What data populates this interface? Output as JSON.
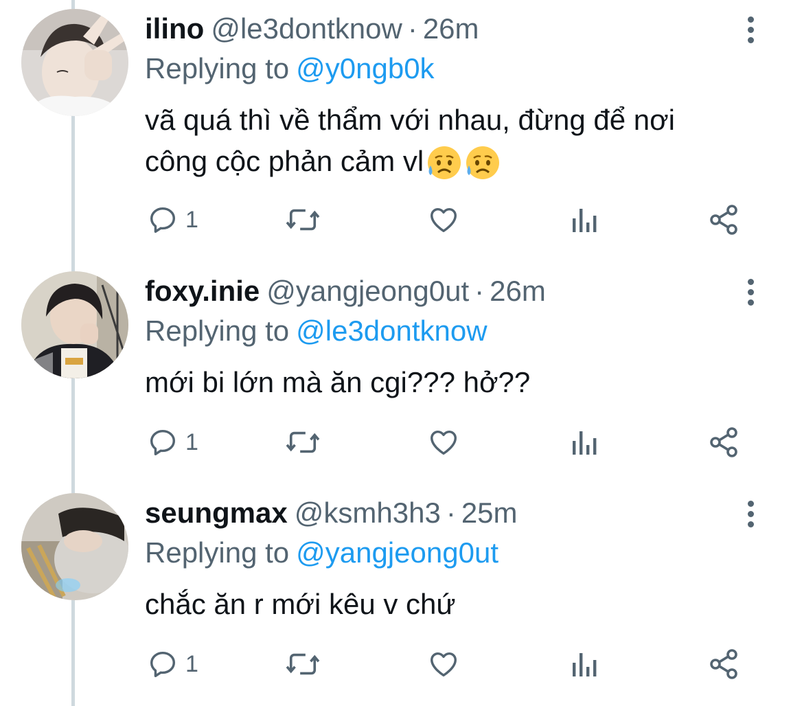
{
  "colors": {
    "text": "#0f1419",
    "secondary": "#536471",
    "accent": "#1d9bf0",
    "thread_line": "#cfd9de"
  },
  "tweets": [
    {
      "display_name": "ilino",
      "handle": "@le3dontknow",
      "separator": "·",
      "time": "26m",
      "replying_label": "Replying to",
      "replying_to": "@y0ngb0k",
      "text_line1": "vã quá thì về thẩm với nhau, đừng để nơi",
      "text_line2": "công cộc phản cảm vl",
      "emoji": [
        "sad-but-relieved-face",
        "sad-but-relieved-face"
      ],
      "reply_count": "1"
    },
    {
      "display_name": "foxy.inie",
      "handle": "@yangjeong0ut",
      "separator": "·",
      "time": "26m",
      "replying_label": "Replying to",
      "replying_to": "@le3dontknow",
      "text_line1": "mới bi lớn mà ăn cgi??? hở??",
      "reply_count": "1"
    },
    {
      "display_name": "seungmax",
      "handle": "@ksmh3h3",
      "separator": "·",
      "time": "25m",
      "replying_label": "Replying to",
      "replying_to": "@yangjeong0ut",
      "text_line1": "chắc ăn r mới kêu v chứ",
      "reply_count": "1"
    }
  ]
}
